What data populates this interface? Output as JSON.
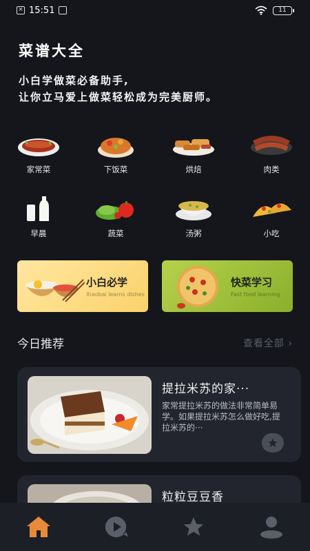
{
  "status_bar": {
    "time": "15:51",
    "battery": "11"
  },
  "header": {
    "title": "菜谱大全",
    "subtitle_line1": "小白学做菜必备助手,",
    "subtitle_line2": "让你立马爱上做菜轻松成为完美厨师。"
  },
  "categories": [
    {
      "label": "家常菜",
      "icon": "fish-dish-icon"
    },
    {
      "label": "下饭菜",
      "icon": "stew-dish-icon"
    },
    {
      "label": "烘焙",
      "icon": "baked-goods-icon"
    },
    {
      "label": "肉类",
      "icon": "sausage-icon"
    },
    {
      "label": "早晨",
      "icon": "milk-icon"
    },
    {
      "label": "蔬菜",
      "icon": "vegetables-icon"
    },
    {
      "label": "汤粥",
      "icon": "soup-bowl-icon"
    },
    {
      "label": "小吃",
      "icon": "taco-icon"
    }
  ],
  "promos": [
    {
      "title": "小白必学",
      "subtitle": "Xiaobai learns dishes"
    },
    {
      "title": "快菜学习",
      "subtitle": "Fast food learning"
    }
  ],
  "today": {
    "title": "今日推荐",
    "see_all": "查看全部 ›"
  },
  "recipes": [
    {
      "title": "提拉米苏的家···",
      "desc": "家常提拉米苏的做法非常简单易学。如果提拉米苏怎么做好吃,提拉米苏的···"
    },
    {
      "title": "粒粒豆豆香",
      "desc": ""
    }
  ],
  "tabs": [
    {
      "name": "home",
      "icon": "home-icon",
      "active": true
    },
    {
      "name": "video",
      "icon": "play-icon",
      "active": false
    },
    {
      "name": "favorites",
      "icon": "star-icon",
      "active": false
    },
    {
      "name": "profile",
      "icon": "user-icon",
      "active": false
    }
  ],
  "colors": {
    "background": "#14161c",
    "card": "#22252d",
    "accent": "#e88a3a",
    "tab_inactive": "#5a5f6a"
  }
}
